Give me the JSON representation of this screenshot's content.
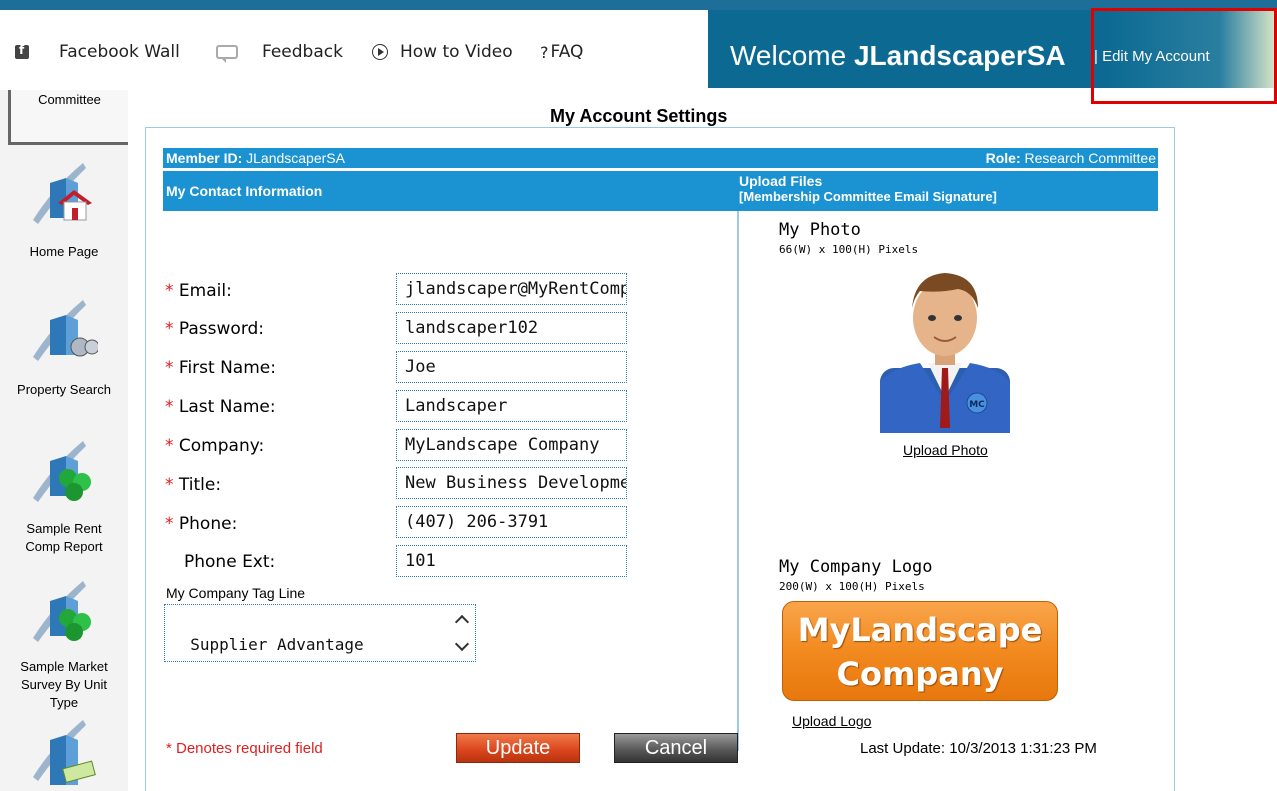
{
  "topnav": {
    "facebook": "Facebook Wall",
    "feedback": "Feedback",
    "video": "How to Video",
    "faq": "FAQ",
    "faq_mark": "?"
  },
  "header": {
    "welcome_prefix": "Welcome ",
    "username": "JLandscaperSA",
    "edit_link": "| Edit My Account"
  },
  "sidebar": {
    "selected_label": "Committee",
    "items": [
      {
        "label": "Home Page"
      },
      {
        "label": "Property Search"
      },
      {
        "label": "Sample Rent Comp Report"
      },
      {
        "label": "Sample Market Survey By Unit Type"
      }
    ]
  },
  "page": {
    "title": "My Account Settings",
    "member_id_label": "Member ID:",
    "member_id": "JLandscaperSA",
    "role_label": "Role:",
    "role": "Research Committee",
    "contact_header": "My Contact Information",
    "upload_header": "Upload Files",
    "upload_sub": "[Membership Committee Email Signature]"
  },
  "form": {
    "email_label": "Email:",
    "email": "jlandscaper@MyRentComps.com",
    "password_label": "Password:",
    "password": "landscaper102",
    "first_name_label": "First Name:",
    "first_name": "Joe",
    "last_name_label": "Last Name:",
    "last_name": "Landscaper",
    "company_label": "Company:",
    "company": "MyLandscape Company",
    "title_label": "Title:",
    "title": "New Business Development",
    "phone_label": "Phone:",
    "phone": "(407) 206-3791",
    "phone_ext_label": "Phone Ext:",
    "phone_ext": "101",
    "tagline_label": "My Company Tag Line",
    "tagline": "Supplier Advantage\nAccess through OMS",
    "required_mark": "*"
  },
  "uploads": {
    "photo_title": "My Photo",
    "photo_dims": "66(W) x 100(H) Pixels",
    "photo_link": "Upload Photo",
    "photo_badge": "MC",
    "logo_title": "My Company Logo",
    "logo_dims": "200(W) x 100(H) Pixels",
    "logo_line1": "MyLandscape",
    "logo_line2": "Company",
    "logo_link": "Upload Logo"
  },
  "footer": {
    "required_note": "* Denotes required field",
    "update": "Update",
    "cancel": "Cancel",
    "last_update": "Last Update: 10/3/2013 1:31:23 PM"
  }
}
